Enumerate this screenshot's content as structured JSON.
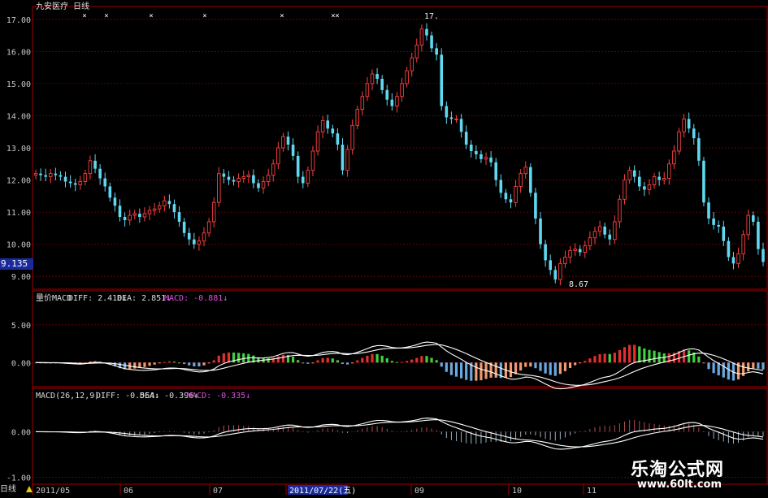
{
  "header": {
    "title": "九安医疗 日线",
    "current_price": "9.135"
  },
  "main_panel": {
    "yticks": [
      "17.00",
      "16.00",
      "15.00",
      "14.00",
      "13.00",
      "12.00",
      "11.00",
      "10.00",
      "9.00"
    ],
    "high_label": "17.",
    "low_label": "8.67"
  },
  "sub1": {
    "name": "量价MACD",
    "diff": "DIFF: 2.410↓",
    "dea": "DEA: 2.851↓",
    "macd": "MACD: -0.881↓",
    "yticks": [
      "5.00",
      "0.00"
    ]
  },
  "sub2": {
    "name": "MACD(26,12,9)",
    "diff": "DIFF: -0.564↓",
    "dea": "DEA: -0.396↓",
    "macd": "MACD: -0.335↓",
    "yticks": [
      "0.00",
      "-1.00"
    ]
  },
  "xaxis": {
    "period_label": "日线",
    "labels": [
      "2011/05",
      "06",
      "07",
      "2011/07/22(五)",
      "09",
      "10",
      "11"
    ]
  },
  "watermark": {
    "cn": "乐淘公式网",
    "url": "www.60lt.com"
  },
  "colors": {
    "up": "#ff4040",
    "down": "#5fd8f0",
    "grid": "#8b0000",
    "hist_red": "#e03030",
    "hist_green": "#40d040",
    "hist_blue": "#6aa8e0",
    "hist_orange": "#f09a70",
    "diff_line": "#ffffff",
    "macd_text": "#e050e0"
  },
  "chart_data": {
    "type": "candlestick",
    "title": "九安医疗 日线",
    "ylim": [
      8.6,
      17.4
    ],
    "close_series": [
      12.2,
      12.15,
      12.1,
      12.2,
      12.15,
      12.1,
      11.95,
      11.9,
      11.85,
      11.95,
      12.2,
      12.6,
      12.35,
      12.05,
      11.8,
      11.45,
      11.2,
      10.85,
      10.75,
      10.9,
      10.95,
      10.85,
      10.95,
      11.05,
      11.1,
      11.2,
      11.35,
      11.25,
      11.0,
      10.7,
      10.35,
      10.15,
      10.0,
      10.1,
      10.35,
      10.7,
      11.3,
      12.2,
      12.1,
      12.0,
      11.95,
      12.05,
      12.1,
      12.15,
      11.9,
      11.75,
      11.95,
      12.15,
      12.5,
      13.0,
      13.35,
      13.1,
      12.75,
      12.1,
      11.9,
      12.3,
      12.9,
      13.5,
      13.85,
      13.6,
      13.45,
      13.1,
      12.3,
      12.95,
      13.7,
      14.2,
      14.6,
      15.0,
      15.3,
      15.15,
      14.8,
      14.5,
      14.3,
      14.6,
      15.0,
      15.4,
      15.8,
      16.2,
      16.7,
      16.5,
      16.1,
      15.9,
      14.3,
      13.95,
      13.9,
      13.9,
      13.5,
      13.1,
      12.9,
      12.8,
      12.65,
      12.7,
      12.55,
      12.0,
      11.6,
      11.4,
      11.3,
      11.8,
      12.2,
      12.4,
      11.6,
      10.8,
      10.0,
      9.5,
      9.2,
      8.9,
      9.4,
      9.6,
      9.8,
      9.85,
      9.75,
      9.95,
      10.2,
      10.4,
      10.55,
      10.3,
      10.15,
      10.7,
      11.4,
      12.0,
      12.3,
      12.1,
      11.8,
      11.7,
      11.85,
      12.1,
      12.0,
      12.05,
      12.5,
      12.9,
      13.5,
      13.9,
      13.6,
      13.3,
      12.6,
      11.3,
      10.8,
      10.6,
      10.55,
      10.1,
      9.6,
      9.4,
      9.7,
      10.3,
      10.9,
      10.7,
      9.85,
      9.45
    ]
  }
}
